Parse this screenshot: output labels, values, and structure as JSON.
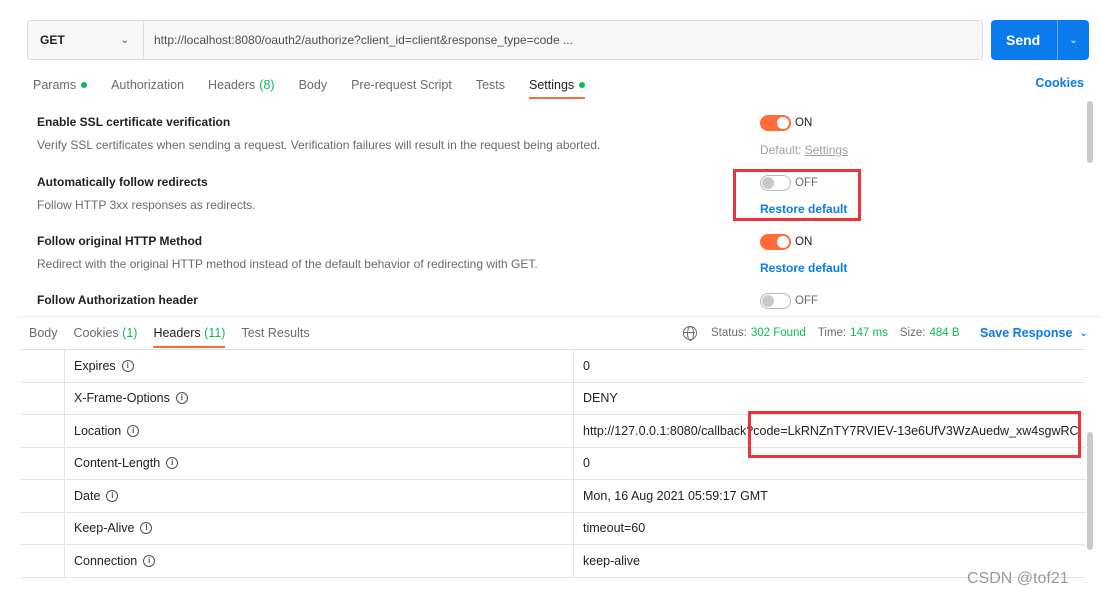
{
  "request": {
    "method": "GET",
    "url": "http://localhost:8080/oauth2/authorize?client_id=client&response_type=code ...",
    "send_label": "Send"
  },
  "request_tabs": [
    {
      "label": "Params",
      "dot": true
    },
    {
      "label": "Authorization"
    },
    {
      "label": "Headers",
      "count": "(8)"
    },
    {
      "label": "Body"
    },
    {
      "label": "Pre-request Script"
    },
    {
      "label": "Tests"
    },
    {
      "label": "Settings",
      "dot": true,
      "active": true
    }
  ],
  "cookies_link": "Cookies",
  "settings": [
    {
      "title": "Enable SSL certificate verification",
      "description": "Verify SSL certificates when sending a request. Verification failures will result in the request being aborted.",
      "state": "ON",
      "hint_prefix": "Default:",
      "hint_link": "Settings"
    },
    {
      "title": "Automatically follow redirects",
      "description": "Follow HTTP 3xx responses as redirects.",
      "state": "OFF",
      "restore": "Restore default"
    },
    {
      "title": "Follow original HTTP Method",
      "description": "Redirect with the original HTTP method instead of the default behavior of redirecting with GET.",
      "state": "ON",
      "restore": "Restore default"
    },
    {
      "title": "Follow Authorization header",
      "state": "OFF"
    }
  ],
  "response_tabs": [
    {
      "label": "Body"
    },
    {
      "label": "Cookies",
      "count": "(1)"
    },
    {
      "label": "Headers",
      "count": "(11)",
      "active": true
    },
    {
      "label": "Test Results"
    }
  ],
  "status": {
    "status_label": "Status:",
    "status_value": "302 Found",
    "time_label": "Time:",
    "time_value": "147 ms",
    "size_label": "Size:",
    "size_value": "484 B"
  },
  "save_response": "Save Response",
  "headers": [
    {
      "key": "Expires",
      "value": "0"
    },
    {
      "key": "X-Frame-Options",
      "value": "DENY"
    },
    {
      "key": "Location",
      "value": "http://127.0.0.1:8080/callback?code=LkRNZnTY7RVIEV-13e6UfV3WzAuedw_xw4sgwRC."
    },
    {
      "key": "Content-Length",
      "value": "0"
    },
    {
      "key": "Date",
      "value": "Mon, 16 Aug 2021 05:59:17 GMT"
    },
    {
      "key": "Keep-Alive",
      "value": "timeout=60"
    },
    {
      "key": "Connection",
      "value": "keep-alive"
    }
  ],
  "info_glyph": "i",
  "watermark": "CSDN @tof21",
  "colors": {
    "accent": "#ff6c37",
    "primary": "#097bed",
    "success": "#0cbb52",
    "annotation": "#e8343a"
  }
}
